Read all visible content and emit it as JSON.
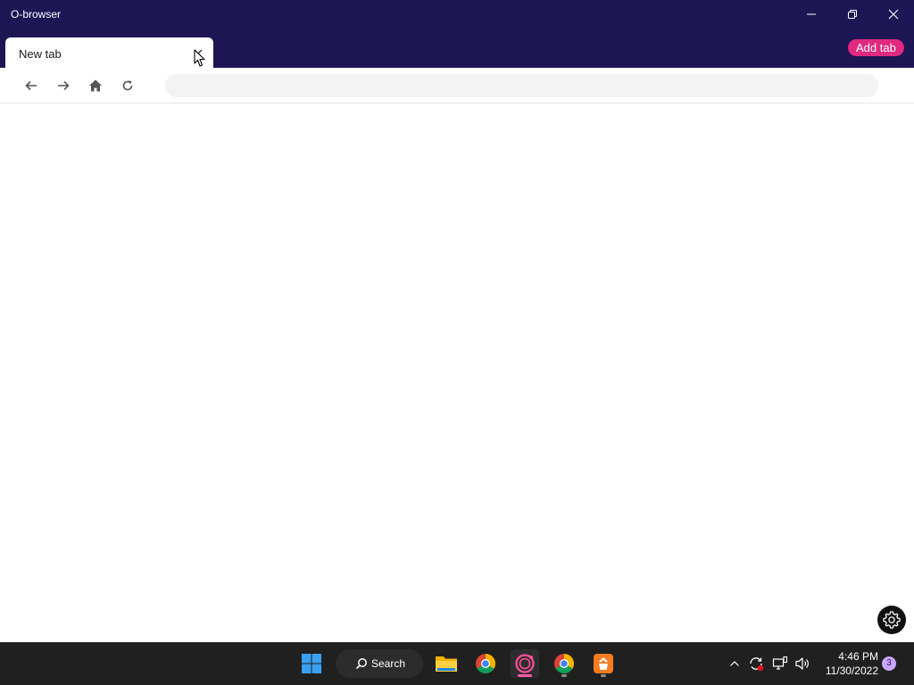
{
  "window": {
    "title": "O-browser",
    "controls": [
      "minimize-icon",
      "restore-icon",
      "close-icon"
    ],
    "titlebar_color": "#1e1654"
  },
  "tabs": [
    {
      "label": "New tab",
      "active": true
    }
  ],
  "add_tab_label": "Add tab",
  "accent_color": "#e0297f",
  "toolbar": {
    "buttons": [
      "back-arrow-icon",
      "forward-arrow-icon",
      "home-icon",
      "reload-icon"
    ],
    "address_value": ""
  },
  "settings_button": "gear-icon",
  "taskbar": {
    "search_label": "Search",
    "apps": [
      "windows-start-icon",
      "file-explorer-icon",
      "chrome-icon",
      "o-browser-icon",
      "chrome-icon",
      "app-icon"
    ],
    "tray": [
      "chevron-up-icon",
      "sync-icon",
      "network-icon",
      "volume-icon"
    ],
    "time": "4:46 PM",
    "date": "11/30/2022",
    "notification_count": "3"
  }
}
